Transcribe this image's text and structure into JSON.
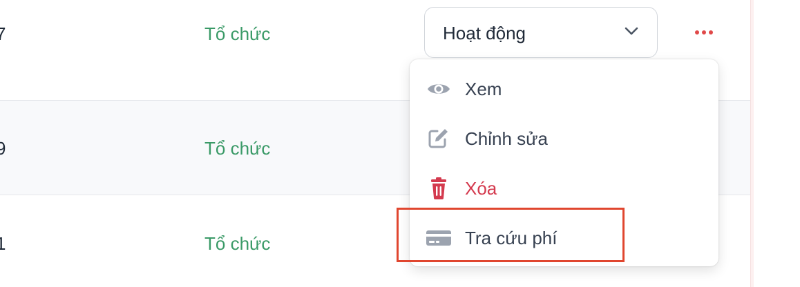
{
  "rows": [
    {
      "id_tail": "7",
      "type": "Tổ chức"
    },
    {
      "id_tail": "9",
      "type": "Tổ chức"
    },
    {
      "id_tail": "1",
      "type": "Tổ chức"
    }
  ],
  "status_select": {
    "value": "Hoạt động",
    "icon": "chevron-down-icon"
  },
  "actions_button": {
    "icon": "more-horizontal-icon"
  },
  "menu": {
    "view": "Xem",
    "edit": "Chỉnh sửa",
    "delete": "Xóa",
    "fee_lookup": "Tra cứu phí"
  },
  "colors": {
    "type_text": "#3a9a67",
    "delete_text": "#d43a4e",
    "more_dots": "#e04848",
    "highlight": "#e0462f",
    "icon_gray": "#9ca3af"
  }
}
